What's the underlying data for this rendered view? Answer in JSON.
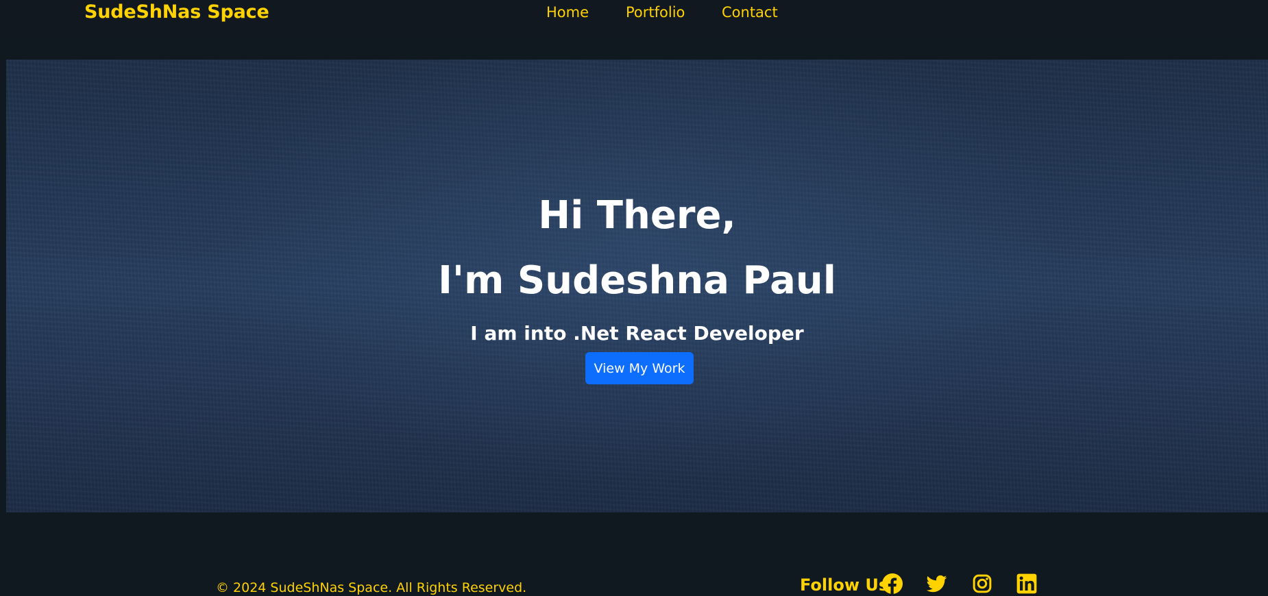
{
  "navbar": {
    "brand": "SudeShNas Space",
    "links": [
      {
        "label": "Home"
      },
      {
        "label": "Portfolio"
      },
      {
        "label": "Contact"
      }
    ]
  },
  "hero": {
    "greeting": "Hi There,",
    "name": "I'm Sudeshna Paul",
    "tagline": "I am into .Net React Developer",
    "cta_label": "View My Work"
  },
  "footer": {
    "copyright": "© 2024 SudeShNas Space. All Rights Reserved.",
    "follow_label": "Follow Us",
    "social_icons": [
      "facebook-icon",
      "twitter-icon",
      "instagram-icon",
      "linkedin-icon"
    ]
  },
  "colors": {
    "accent": "#ffd200",
    "background": "#111820",
    "button": "#0d6efd",
    "text": "#ffffff"
  }
}
